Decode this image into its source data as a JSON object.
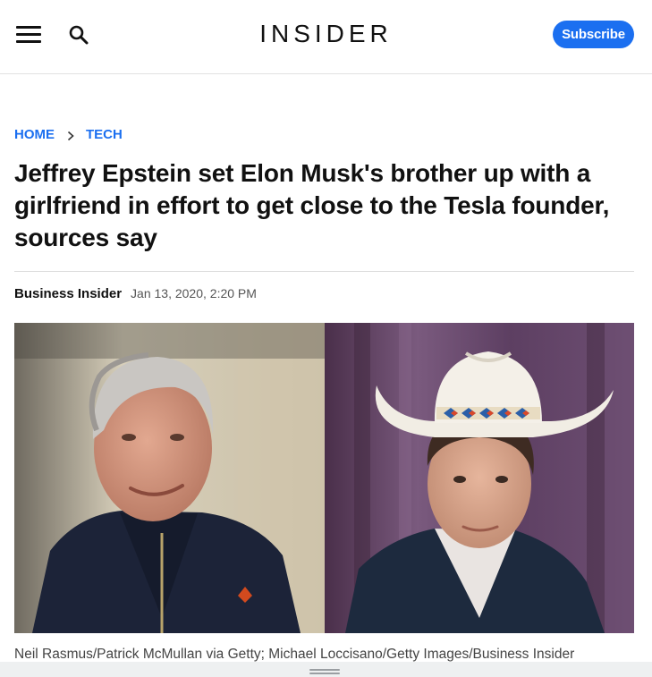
{
  "header": {
    "logo_text": "INSIDER",
    "subscribe_label": "Subscribe",
    "menu_icon": "hamburger-menu-icon",
    "search_icon": "search-icon",
    "accent_color": "#1b6ff0"
  },
  "breadcrumb": {
    "items": [
      {
        "label": "HOME"
      },
      {
        "label": "TECH"
      }
    ],
    "separator_icon": "chevron-right-icon"
  },
  "article": {
    "headline": "Jeffrey Epstein set Elon Musk's brother up with a girlfriend in effort to get close to the Tesla founder, sources say",
    "author": "Business Insider",
    "date": "Jan 13, 2020, 2:20 PM",
    "image_caption": "Neil Rasmus/Patrick McMullan via Getty; Michael Loccisano/Getty Images/Business Insider"
  }
}
